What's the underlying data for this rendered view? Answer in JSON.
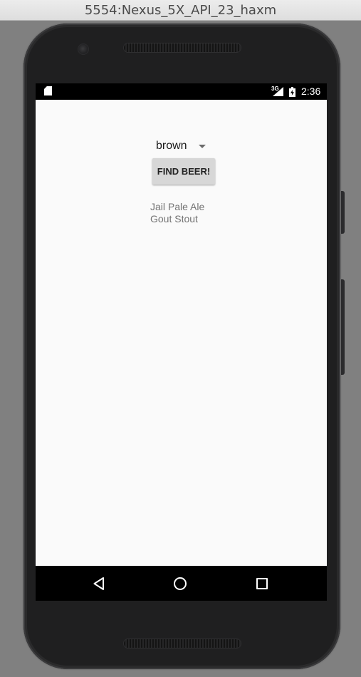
{
  "window": {
    "title": "5554:Nexus_5X_API_23_haxm"
  },
  "status_bar": {
    "network": "3G",
    "time": "2:36"
  },
  "app": {
    "spinner": {
      "selected": "brown"
    },
    "find_button": {
      "label": "FIND BEER!"
    },
    "results": [
      "Jail Pale Ale",
      "Gout Stout"
    ]
  },
  "nav_bar": {
    "back_icon": "back-triangle-icon",
    "home_icon": "home-circle-icon",
    "recents_icon": "recents-square-icon"
  },
  "colors": {
    "app_background": "#fafafa",
    "button_background": "#d7d7d7",
    "result_text": "#737373",
    "emulator_background": "#808080"
  }
}
